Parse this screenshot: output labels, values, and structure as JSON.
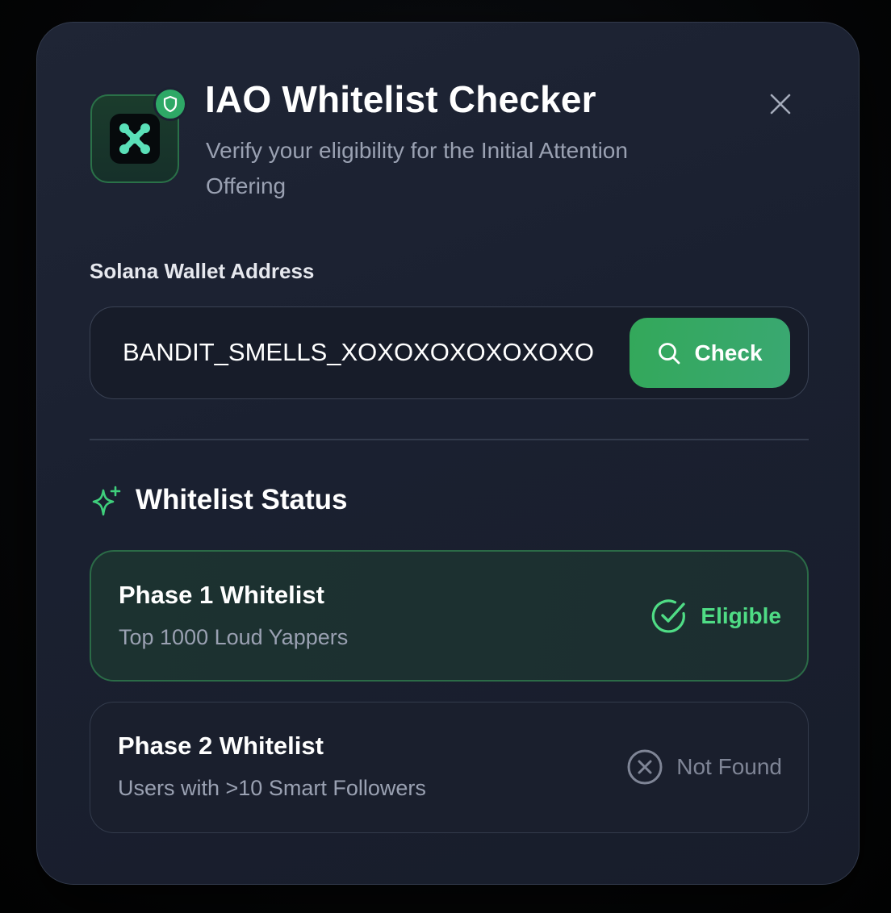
{
  "header": {
    "title": "IAO Whitelist Checker",
    "subtitle": "Verify your eligibility for the Initial Attention Offering",
    "app_icon": "x-logo-icon",
    "badge_icon": "shield-icon",
    "close_icon": "close-icon"
  },
  "wallet": {
    "label": "Solana Wallet Address",
    "value": "BANDIT_SMELLS_XOXOXOXOXOXOXO",
    "placeholder": "",
    "button_label": "Check",
    "button_icon": "search-icon"
  },
  "status_section": {
    "title": "Whitelist Status",
    "icon": "sparkle-icon",
    "phases": [
      {
        "name": "Phase 1 Whitelist",
        "description": "Top 1000 Loud Yappers",
        "status": "Eligible",
        "status_icon": "check-circle-icon"
      },
      {
        "name": "Phase 2 Whitelist",
        "description": "Users with >10 Smart Followers",
        "status": "Not Found",
        "status_icon": "x-circle-icon"
      }
    ]
  },
  "colors": {
    "accent": "#33a85a",
    "eligible": "#4fdc85",
    "not_found": "#7f8596",
    "card_background": "#1a1f2d"
  }
}
